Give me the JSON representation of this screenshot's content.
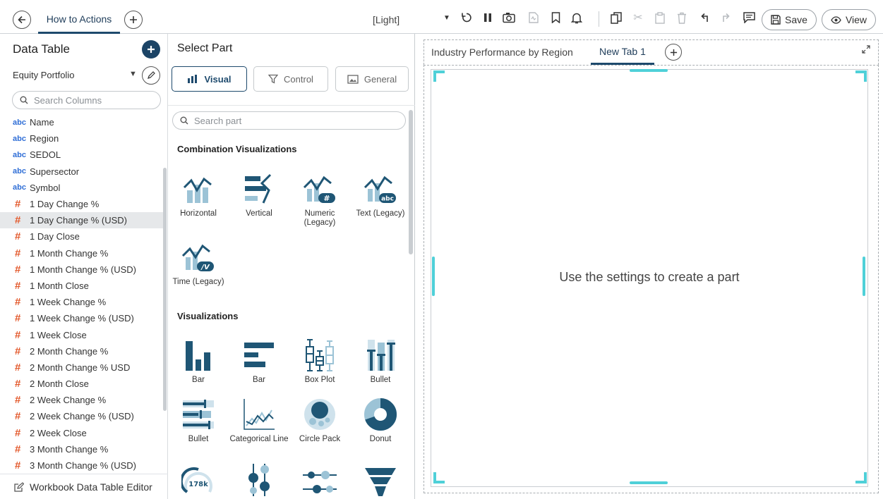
{
  "topbar": {
    "doc_tab": "How to Actions",
    "theme": "[Light]",
    "save_label": "Save",
    "view_label": "View"
  },
  "data_table": {
    "title": "Data Table",
    "source": "Equity Portfolio",
    "search_placeholder": "Search Columns",
    "columns": [
      {
        "type": "abc",
        "name": "Name"
      },
      {
        "type": "abc",
        "name": "Region"
      },
      {
        "type": "abc",
        "name": "SEDOL"
      },
      {
        "type": "abc",
        "name": "Supersector"
      },
      {
        "type": "abc",
        "name": "Symbol"
      },
      {
        "type": "#",
        "name": "1 Day Change %"
      },
      {
        "type": "#",
        "name": "1 Day Change % (USD)"
      },
      {
        "type": "#",
        "name": "1 Day Close"
      },
      {
        "type": "#",
        "name": "1 Month Change %"
      },
      {
        "type": "#",
        "name": "1 Month Change % (USD)"
      },
      {
        "type": "#",
        "name": "1 Month Close"
      },
      {
        "type": "#",
        "name": "1 Week Change %"
      },
      {
        "type": "#",
        "name": "1 Week Change % (USD)"
      },
      {
        "type": "#",
        "name": "1 Week Close"
      },
      {
        "type": "#",
        "name": "2 Month Change %"
      },
      {
        "type": "#",
        "name": "2 Month Change % USD"
      },
      {
        "type": "#",
        "name": "2 Month Close"
      },
      {
        "type": "#",
        "name": "2 Week Change %"
      },
      {
        "type": "#",
        "name": "2 Week Change % (USD)"
      },
      {
        "type": "#",
        "name": "2 Week Close"
      },
      {
        "type": "#",
        "name": "3 Month Change %"
      },
      {
        "type": "#",
        "name": "3 Month Change % (USD)"
      }
    ],
    "selected_column": "1 Day Change % (USD)",
    "footer_label": "Workbook Data Table Editor"
  },
  "select_part": {
    "title": "Select Part",
    "tabs": [
      {
        "label": "Visual",
        "icon": "bar-chart-icon",
        "active": true
      },
      {
        "label": "Control",
        "icon": "filter-icon",
        "active": false
      },
      {
        "label": "General",
        "icon": "image-icon",
        "active": false
      }
    ],
    "search_placeholder": "Search part",
    "combination_title": "Combination Visualizations",
    "combination": [
      {
        "label": "Horizontal",
        "icon": "combo-horizontal-icon"
      },
      {
        "label": "Vertical",
        "icon": "combo-vertical-icon"
      },
      {
        "label": "Numeric (Legacy)",
        "icon": "combo-numeric-icon",
        "badge": "#"
      },
      {
        "label": "Text (Legacy)",
        "icon": "combo-text-icon",
        "badge": "abc"
      },
      {
        "label": "Time (Legacy)",
        "icon": "combo-time-icon",
        "badge": "/V"
      }
    ],
    "visualizations_title": "Visualizations",
    "visualizations": [
      {
        "label": "Bar",
        "icon": "bar-vertical-icon"
      },
      {
        "label": "Bar",
        "icon": "bar-horizontal-icon"
      },
      {
        "label": "Box Plot",
        "icon": "box-plot-icon"
      },
      {
        "label": "Bullet",
        "icon": "bullet-vertical-icon"
      },
      {
        "label": "Bullet",
        "icon": "bullet-horizontal-icon"
      },
      {
        "label": "Categorical Line",
        "icon": "categorical-line-icon"
      },
      {
        "label": "Circle Pack",
        "icon": "circle-pack-icon"
      },
      {
        "label": "Donut",
        "icon": "donut-icon"
      },
      {
        "label": "",
        "icon": "dial-gauge-icon",
        "badge": "178k"
      },
      {
        "label": "",
        "icon": "dot-plot-vertical-icon"
      },
      {
        "label": "",
        "icon": "dot-plot-horizontal-icon"
      },
      {
        "label": "",
        "icon": "funnel-icon"
      }
    ]
  },
  "canvas": {
    "tabs": [
      "Industry Performance by Region",
      "New Tab 1"
    ],
    "active_tab": "New Tab 1",
    "hint": "Use the settings to create a part"
  },
  "colors": {
    "accent": "#1e4a6d",
    "icon_dark": "#1f5675",
    "icon_light": "#9cc3d6",
    "handle": "#4fd0d8",
    "number_type": "#e35a2d",
    "text_type": "#2f6ed6"
  }
}
